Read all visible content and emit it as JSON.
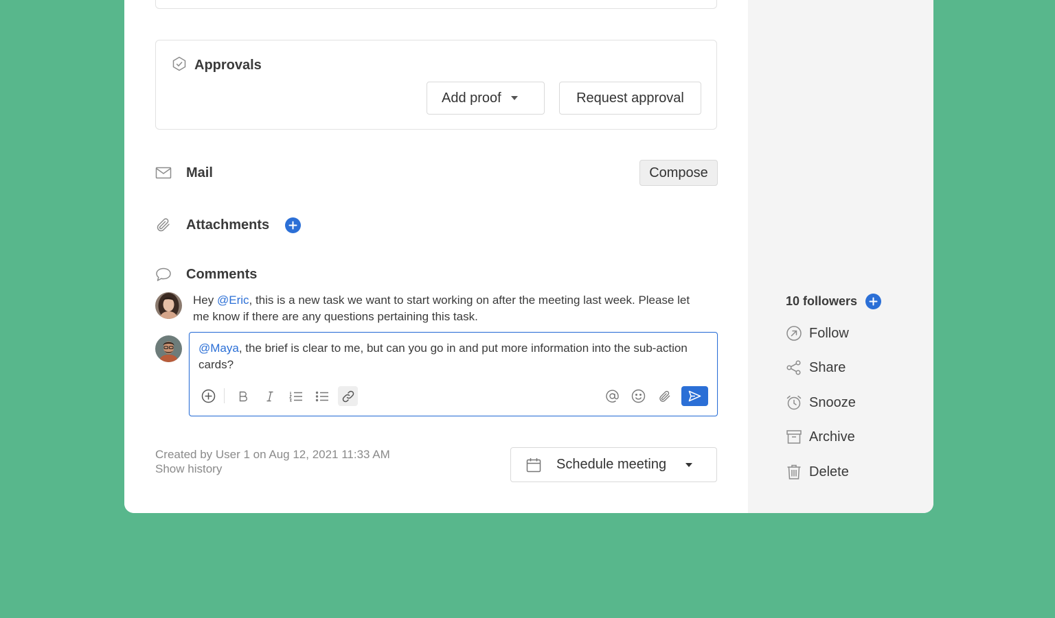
{
  "approvals": {
    "title": "Approvals",
    "add_proof": "Add proof",
    "request_approval": "Request approval"
  },
  "mail": {
    "label": "Mail",
    "compose": "Compose"
  },
  "attachments": {
    "label": "Attachments"
  },
  "comments": {
    "label": "Comments",
    "items": [
      {
        "prefix": "Hey ",
        "mention": "@Eric",
        "text": ", this is a new task we want to start working on after the meeting last week. Please let me know if there are any questions pertaining this task."
      }
    ],
    "editor": {
      "mention": "@Maya",
      "text": ", the brief is clear to me, but can you go in and put more information into the sub-action cards?"
    }
  },
  "meta": {
    "created": "Created by User 1 on Aug 12, 2021 11:33 AM",
    "history": "Show history"
  },
  "schedule": {
    "label": "Schedule meeting"
  },
  "sidebar": {
    "followers": "10 followers",
    "actions": [
      {
        "label": "Follow",
        "icon": "follow-icon"
      },
      {
        "label": "Share",
        "icon": "share-icon"
      },
      {
        "label": "Snooze",
        "icon": "alarm-clock-icon"
      },
      {
        "label": "Archive",
        "icon": "archive-icon"
      },
      {
        "label": "Delete",
        "icon": "trash-icon"
      }
    ]
  },
  "colors": {
    "background": "#58b78c",
    "accent": "#2b6fd6",
    "sidebar": "#f4f4f4"
  }
}
